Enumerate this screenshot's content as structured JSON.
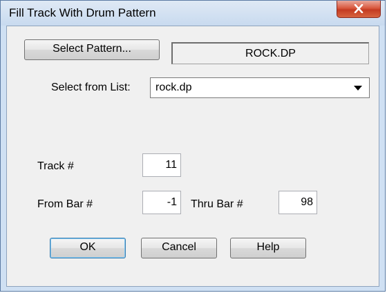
{
  "window": {
    "title": "Fill Track With Drum Pattern"
  },
  "pattern": {
    "select_button": "Select Pattern...",
    "current_name": "ROCK.DP"
  },
  "list": {
    "label": "Select from List:",
    "selected": "rock.dp"
  },
  "track": {
    "label": "Track #",
    "value": "11"
  },
  "from_bar": {
    "label": "From Bar #",
    "value": "-1"
  },
  "thru_bar": {
    "label": "Thru Bar #",
    "value": "98"
  },
  "buttons": {
    "ok": "OK",
    "cancel": "Cancel",
    "help": "Help"
  }
}
